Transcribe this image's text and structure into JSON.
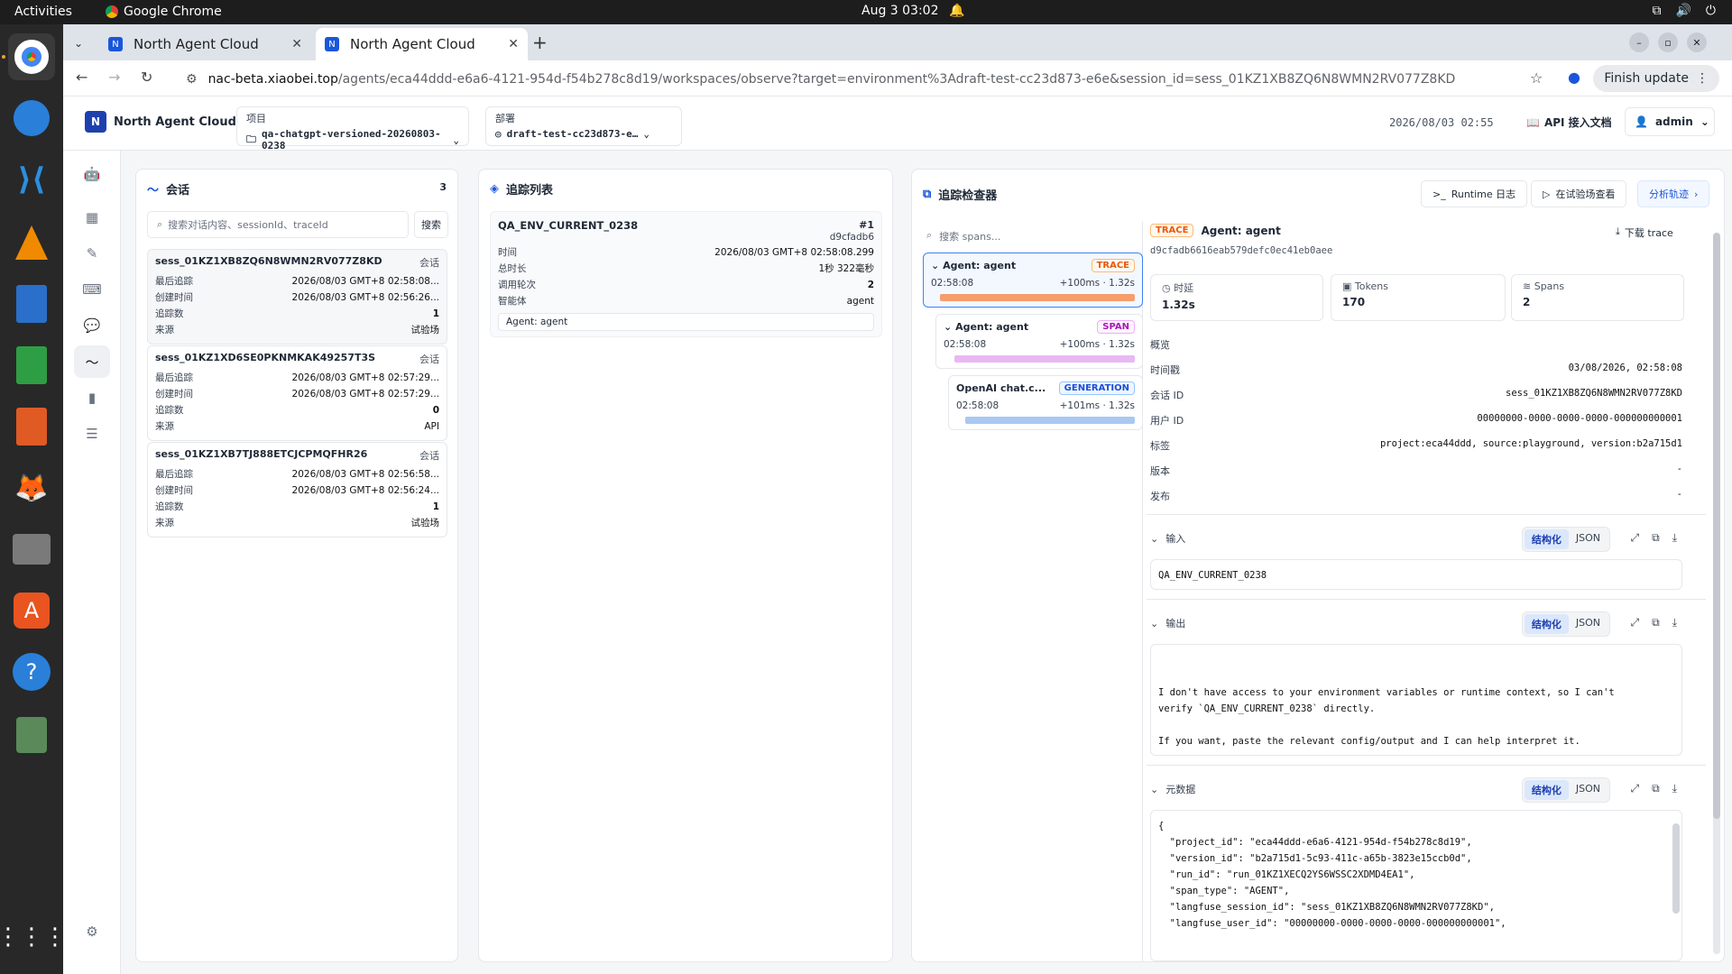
{
  "os": {
    "activities": "Activities",
    "app_name": "Google Chrome",
    "clock": "Aug 3  03:02"
  },
  "browser": {
    "tabs": [
      {
        "title": "North Agent Cloud"
      },
      {
        "title": "North Agent Cloud"
      }
    ],
    "url_host": "nac-beta.xiaobei.top",
    "url_path": "/agents/eca44ddd-e6a6-4121-954d-f54b278c8d19/workspaces/observe?target=environment%3Adraft-test-cc23d873-e6e&session_id=sess_01KZ1XB8ZQ6N8WMN2RV077Z8KD",
    "finish_update": "Finish update"
  },
  "header": {
    "brand": "North Agent Cloud",
    "project_label": "项目",
    "project_value": "qa-chatgpt-versioned-20260803-0238",
    "deploy_label": "部署",
    "deploy_value": "draft-test-cc23d873-e…",
    "time": "2026/08/03 02:55",
    "api_doc": "API 接入文档",
    "user": "admin"
  },
  "sessions": {
    "title": "会话",
    "count": "3",
    "search_placeholder": "搜索对话内容、sessionId、traceId",
    "search_button": "搜索",
    "items": [
      {
        "id": "sess_01KZ1XB8ZQ6N8WMN2RV077Z8KD",
        "badge": "会话",
        "rows": [
          [
            "最后追踪",
            "2026/08/03 GMT+8 02:58:08..."
          ],
          [
            "创建时间",
            "2026/08/03 GMT+8 02:56:26..."
          ],
          [
            "追踪数",
            "1"
          ],
          [
            "来源",
            "试验场"
          ]
        ]
      },
      {
        "id": "sess_01KZ1XD6SE0PKNMKAK49257T3S",
        "badge": "会话",
        "rows": [
          [
            "最后追踪",
            "2026/08/03 GMT+8 02:57:29..."
          ],
          [
            "创建时间",
            "2026/08/03 GMT+8 02:57:29..."
          ],
          [
            "追踪数",
            "0"
          ],
          [
            "来源",
            "API"
          ]
        ]
      },
      {
        "id": "sess_01KZ1XB7TJ888ETCJCPMQFHR26",
        "badge": "会话",
        "rows": [
          [
            "最后追踪",
            "2026/08/03 GMT+8 02:56:58..."
          ],
          [
            "创建时间",
            "2026/08/03 GMT+8 02:56:24..."
          ],
          [
            "追踪数",
            "1"
          ],
          [
            "来源",
            "试验场"
          ]
        ]
      }
    ]
  },
  "traces": {
    "title": "追踪列表",
    "item": {
      "name": "QA_ENV_CURRENT_0238",
      "num": "#1",
      "hash": "d9cfadb6",
      "rows": [
        [
          "时间",
          "2026/08/03 GMT+8 02:58:08.299"
        ],
        [
          "总时长",
          "1秒 322毫秒"
        ],
        [
          "调用轮次",
          "2"
        ],
        [
          "智能体",
          "agent"
        ]
      ],
      "chip": "Agent: agent"
    }
  },
  "inspector": {
    "title": "追踪检查器",
    "runtime_log": "Runtime 日志",
    "playground": "在试验场查看",
    "analyze": "分析轨迹",
    "span_search": "搜索 spans...",
    "spans": [
      {
        "name": "Agent: agent",
        "tag": "TRACE",
        "time": "02:58:08",
        "dur": "+100ms · 1.32s",
        "color": "#f59e6b"
      },
      {
        "name": "Agent: agent",
        "tag": "SPAN",
        "time": "02:58:08",
        "dur": "+100ms · 1.32s",
        "color": "#e9b8f4"
      },
      {
        "name": "OpenAI chat.c...",
        "tag": "GENERATION",
        "time": "02:58:08",
        "dur": "+101ms · 1.32s",
        "color": "#a9c8f2"
      }
    ],
    "detail": {
      "tag": "TRACE",
      "name": "Agent: agent",
      "trace_id": "d9cfadb6616eab579defc0ec41eb0aee",
      "download": "下载 trace",
      "stats": [
        [
          "时延",
          "1.32s"
        ],
        [
          "Tokens",
          "170"
        ],
        [
          "Spans",
          "2"
        ]
      ],
      "overview": "概览",
      "kv": [
        [
          "时间戳",
          "03/08/2026, 02:58:08"
        ],
        [
          "会话 ID",
          "sess_01KZ1XB8ZQ6N8WMN2RV077Z8KD"
        ],
        [
          "用户 ID",
          "00000000-0000-0000-0000-000000000001"
        ],
        [
          "标签",
          "project:eca44ddd, source:playground, version:b2a715d1"
        ],
        [
          "版本",
          "-"
        ],
        [
          "发布",
          "-"
        ]
      ],
      "input_label": "输入",
      "input_value": "QA_ENV_CURRENT_0238",
      "output_label": "输出",
      "output_line1": "I don't have access to your environment variables or runtime context, so I can't",
      "output_line2": "verify `QA_ENV_CURRENT_0238` directly.",
      "output_line3": "If you want, paste the relevant config/output and I can help interpret it.",
      "meta_label": "元数据",
      "seg_struct": "结构化",
      "seg_json": "JSON",
      "meta_lines": [
        "{",
        "  \"project_id\": \"eca44ddd-e6a6-4121-954d-f54b278c8d19\",",
        "  \"version_id\": \"b2a715d1-5c93-411c-a65b-3823e15ccb0d\",",
        "  \"run_id\": \"run_01KZ1XECQ2YS6WSSC2XDMD4EA1\",",
        "  \"span_type\": \"AGENT\",",
        "  \"langfuse_session_id\": \"sess_01KZ1XB8ZQ6N8WMN2RV077Z8KD\",",
        "  \"langfuse_user_id\": \"00000000-0000-0000-0000-000000000001\","
      ]
    }
  }
}
